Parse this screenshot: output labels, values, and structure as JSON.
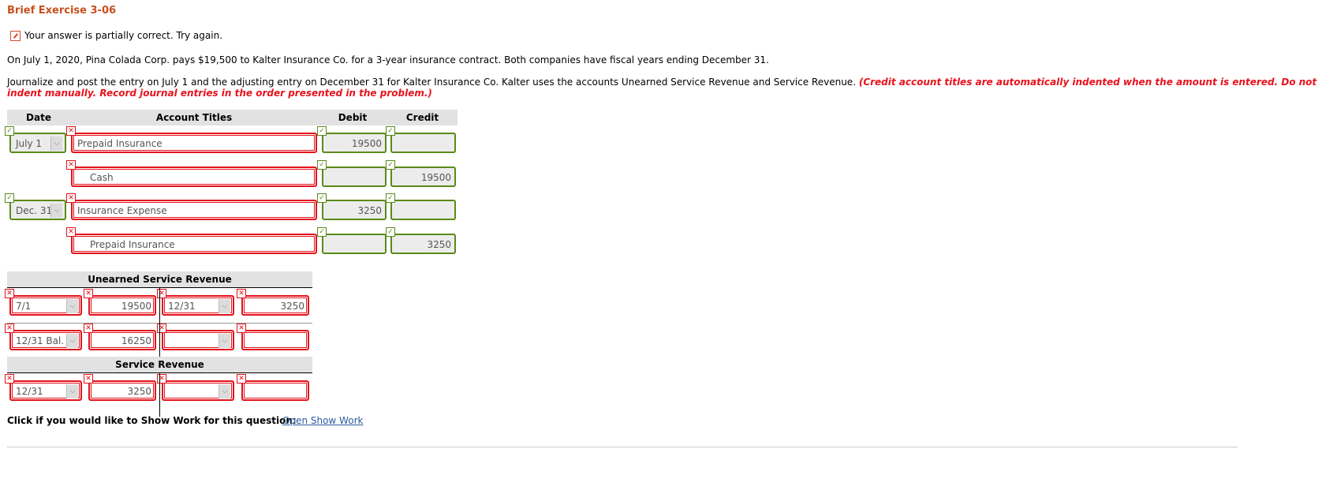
{
  "title": "Brief Exercise 3-06",
  "status_message": "Your answer is partially correct.  Try again.",
  "problem_text": "On July 1, 2020, Pina Colada Corp. pays $19,500 to Kalter Insurance Co. for a 3-year insurance contract. Both companies have fiscal years ending December 31.",
  "instructions": "Journalize and post the entry on July 1 and the adjusting entry on December 31 for Kalter Insurance Co. Kalter uses the accounts Unearned Service Revenue and Service Revenue. ",
  "instructions_note": "(Credit account titles are automatically indented when the amount is entered. Do not indent manually. Record journal entries in the order presented in the problem.)",
  "journal": {
    "headers": {
      "date": "Date",
      "account": "Account Titles",
      "debit": "Debit",
      "credit": "Credit"
    },
    "rows": [
      {
        "date": "July 1",
        "account": "Prepaid Insurance",
        "debit": "19500",
        "credit": "",
        "date_status": "correct",
        "account_status": "incorrect",
        "debit_status": "correct",
        "credit_status": "correct"
      },
      {
        "date": "",
        "account": "Cash",
        "debit": "",
        "credit": "19500",
        "account_status": "incorrect",
        "debit_status": "correct",
        "credit_status": "correct"
      },
      {
        "date": "Dec. 31",
        "account": "Insurance Expense",
        "debit": "3250",
        "credit": "",
        "date_status": "correct",
        "account_status": "incorrect",
        "debit_status": "correct",
        "credit_status": "correct"
      },
      {
        "date": "",
        "account": "Prepaid Insurance",
        "debit": "",
        "credit": "3250",
        "account_status": "incorrect",
        "debit_status": "correct",
        "credit_status": "correct"
      }
    ]
  },
  "t_accounts": [
    {
      "name": "Unearned Service Revenue",
      "rows": [
        {
          "left_date": "7/1",
          "left_amount": "19500",
          "right_date": "12/31",
          "right_amount": "3250"
        },
        {
          "left_date": "12/31 Bal.",
          "left_amount": "16250",
          "right_date": "",
          "right_amount": ""
        }
      ]
    },
    {
      "name": "Service Revenue",
      "rows": [
        {
          "left_date": "12/31",
          "left_amount": "3250",
          "right_date": "",
          "right_amount": ""
        }
      ]
    }
  ],
  "show_work_prompt": "Click if you would like to Show Work for this question:",
  "show_work_link": "Open Show Work",
  "icons": {
    "correct": "✓",
    "incorrect": "✕",
    "dropdown": "⌵"
  }
}
